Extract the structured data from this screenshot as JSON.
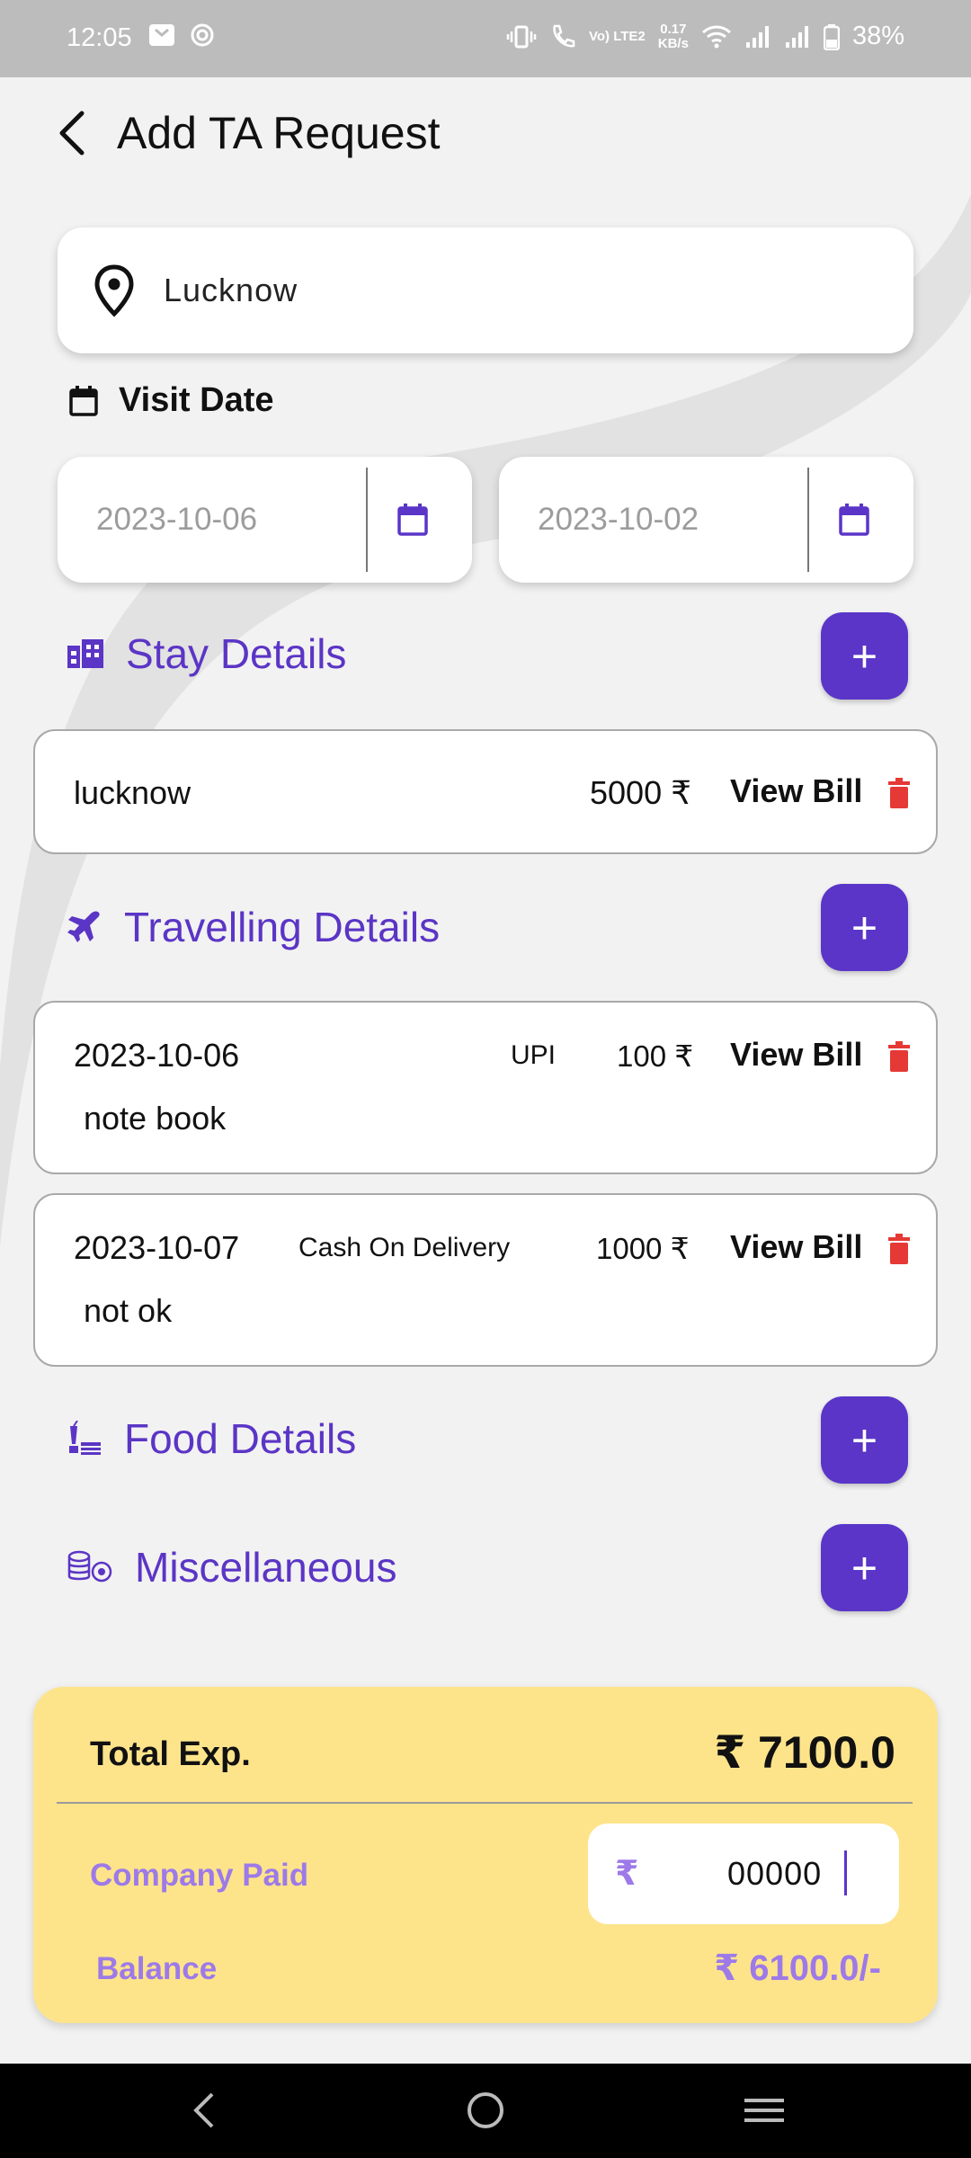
{
  "status_bar": {
    "time": "12:05",
    "net_speed_value": "0.17",
    "net_speed_unit": "KB/s",
    "network_type": "Vo) LTE2",
    "battery": "38%"
  },
  "header": {
    "title": "Add TA Request"
  },
  "location": {
    "value": "Lucknow"
  },
  "visit_date": {
    "label": "Visit Date",
    "from": "2023-10-06",
    "to": "2023-10-02"
  },
  "stay": {
    "title": "Stay Details",
    "add_label": "+",
    "items": [
      {
        "place": "lucknow",
        "amount": "5000 ₹",
        "view_label": "View Bill"
      }
    ]
  },
  "travel": {
    "title": "Travelling Details",
    "add_label": "+",
    "items": [
      {
        "date": "2023-10-06",
        "mode": "UPI",
        "amount": "100 ₹",
        "view_label": "View Bill",
        "note": "note book"
      },
      {
        "date": "2023-10-07",
        "mode": "Cash On Delivery",
        "amount": "1000 ₹",
        "view_label": "View Bill",
        "note": "not ok"
      }
    ]
  },
  "food": {
    "title": "Food Details",
    "add_label": "+"
  },
  "misc": {
    "title": "Miscellaneous",
    "add_label": "+"
  },
  "summary": {
    "total_label": "Total Exp.",
    "total_value": "₹ 7100.0",
    "company_paid_label": "Company Paid",
    "currency_symbol": "₹",
    "company_paid_value": "00000",
    "balance_label": "Balance",
    "balance_value": "₹ 6100.0/-"
  },
  "colors": {
    "accent": "#5a35c8",
    "delete": "#e53935",
    "summary_bg": "#fde48b",
    "muted_accent": "#9d7ae8"
  },
  "icons": [
    "back-arrow-icon",
    "location-pin-icon",
    "calendar-icon",
    "hotel-icon",
    "airplane-icon",
    "food-icon",
    "coins-icon",
    "trash-icon",
    "plus-icon"
  ]
}
